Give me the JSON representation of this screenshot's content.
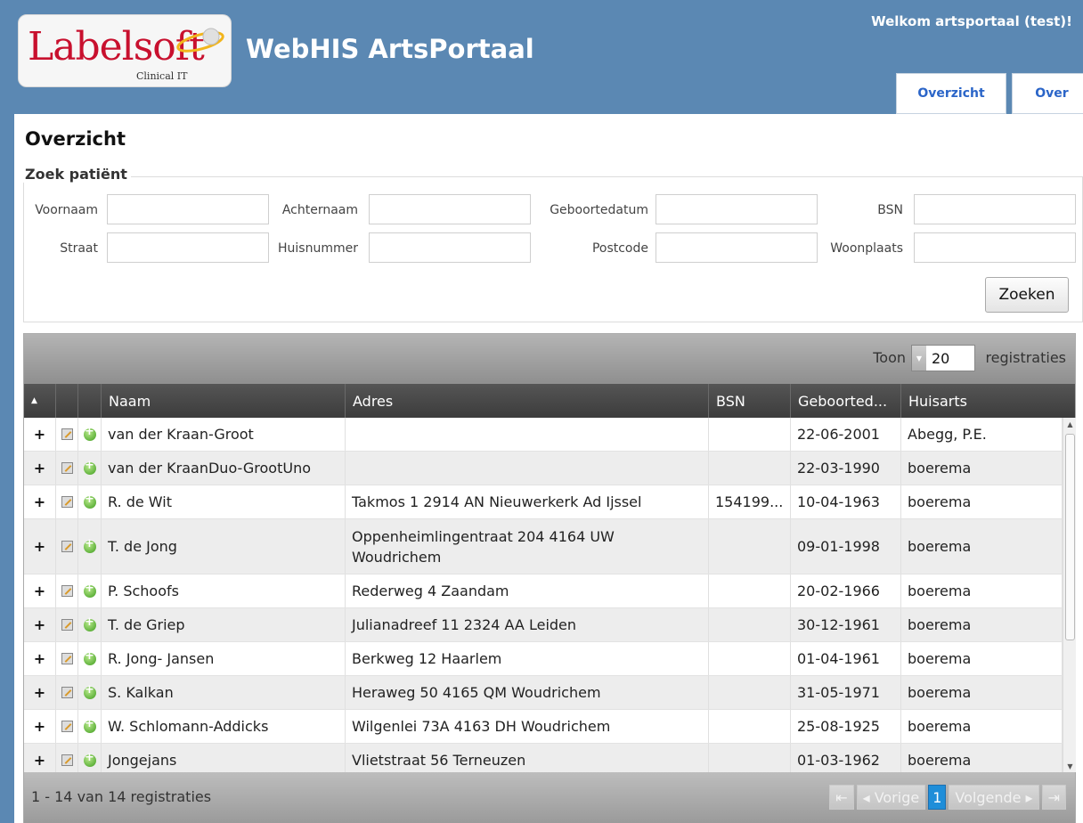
{
  "header": {
    "logo_text": "Labelsoft",
    "logo_sub": "Clinical IT",
    "app_title": "WebHIS ArtsPortaal",
    "welcome": "Welkom artsportaal (test)!",
    "tabs": [
      {
        "label": "Overzicht"
      },
      {
        "label": "Over"
      }
    ],
    "brand_color": "#5b88b3"
  },
  "page": {
    "title": "Overzicht",
    "search": {
      "legend": "Zoek patiënt",
      "labels": {
        "voornaam": "Voornaam",
        "achternaam": "Achternaam",
        "geboortedatum": "Geboortedatum",
        "bsn": "BSN",
        "straat": "Straat",
        "huisnummer": "Huisnummer",
        "postcode": "Postcode",
        "woonplaats": "Woonplaats"
      },
      "button": "Zoeken"
    }
  },
  "grid": {
    "toon_label": "Toon",
    "page_size": "20",
    "registraties_label": "registraties",
    "columns": [
      "",
      "",
      "",
      "Naam",
      "Adres",
      "BSN",
      "Geboorted...",
      "Huisarts"
    ],
    "sort_icon": "sort-up-icon",
    "rows": [
      {
        "naam": "van der Kraan-Groot",
        "adres": "",
        "bsn": "",
        "geboortedatum": "22-06-2001",
        "huisarts": "Abegg, P.E."
      },
      {
        "naam": "van der KraanDuo-GrootUno",
        "adres": "",
        "bsn": "",
        "geboortedatum": "22-03-1990",
        "huisarts": "boerema"
      },
      {
        "naam": "R. de Wit",
        "adres": "Takmos 1 2914 AN Nieuwerkerk Ad Ijssel",
        "bsn": "154199...",
        "geboortedatum": "10-04-1963",
        "huisarts": "boerema"
      },
      {
        "naam": "T. de Jong",
        "adres": "Oppenheimlingentraat 204 4164 UW Woudrichem",
        "bsn": "",
        "geboortedatum": "09-01-1998",
        "huisarts": "boerema"
      },
      {
        "naam": "P. Schoofs",
        "adres": "Rederweg 4 Zaandam",
        "bsn": "",
        "geboortedatum": "20-02-1966",
        "huisarts": "boerema"
      },
      {
        "naam": "T. de Griep",
        "adres": "Julianadreef 11 2324 AA Leiden",
        "bsn": "",
        "geboortedatum": "30-12-1961",
        "huisarts": "boerema"
      },
      {
        "naam": "R. Jong- Jansen",
        "adres": "Berkweg 12 Haarlem",
        "bsn": "",
        "geboortedatum": "01-04-1961",
        "huisarts": "boerema"
      },
      {
        "naam": "S. Kalkan",
        "adres": "Heraweg 50 4165 QM Woudrichem",
        "bsn": "",
        "geboortedatum": "31-05-1971",
        "huisarts": "boerema"
      },
      {
        "naam": "W. Schlomann-Addicks",
        "adres": "Wilgenlei 73A 4163 DH Woudrichem",
        "bsn": "",
        "geboortedatum": "25-08-1925",
        "huisarts": "boerema"
      },
      {
        "naam": "Jongejans",
        "adres": "Vlietstraat 56 Terneuzen",
        "bsn": "",
        "geboortedatum": "01-03-1962",
        "huisarts": "boerema"
      }
    ],
    "footer_info": "1 - 14 van 14 registraties",
    "pager": {
      "prev": "Vorige",
      "current": "1",
      "next": "Volgende"
    }
  }
}
